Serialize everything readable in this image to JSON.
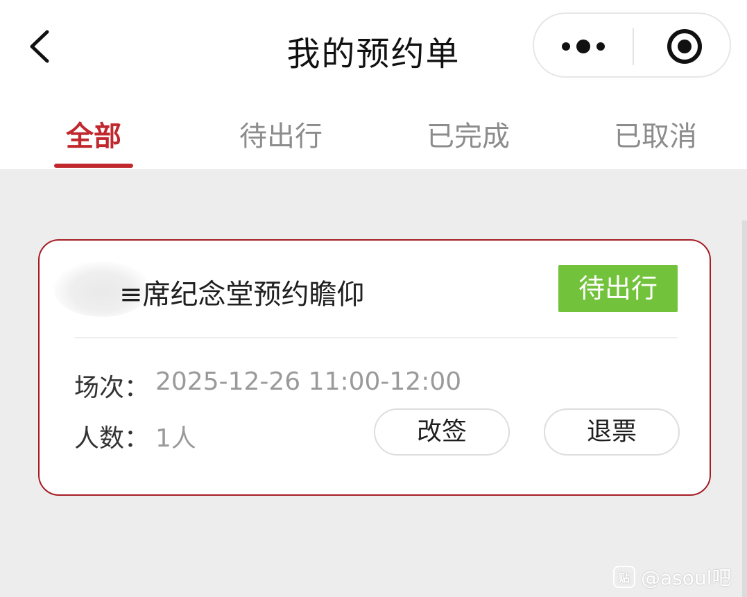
{
  "header": {
    "title": "我的预约单",
    "back_icon": "chevron-left-icon",
    "more_icon": "more-dots-icon",
    "target_icon": "target-circle-icon"
  },
  "tabs": [
    {
      "label": "全部",
      "active": true
    },
    {
      "label": "待出行",
      "active": false
    },
    {
      "label": "已完成",
      "active": false
    },
    {
      "label": "已取消",
      "active": false
    }
  ],
  "booking": {
    "title": "≡席纪念堂预约瞻仰",
    "status": "待出行",
    "session_label": "场次：",
    "session_value": "2025-12-26 11:00-12:00",
    "people_label": "人数：",
    "people_value": "1人",
    "reschedule_label": "改签",
    "refund_label": "退票"
  },
  "watermark": {
    "logo_text": "贴",
    "text": "@asoul吧"
  },
  "colors": {
    "accent": "#c0282d",
    "card_border": "#a51c24",
    "status_green": "#73c23b",
    "background": "#ededed"
  }
}
